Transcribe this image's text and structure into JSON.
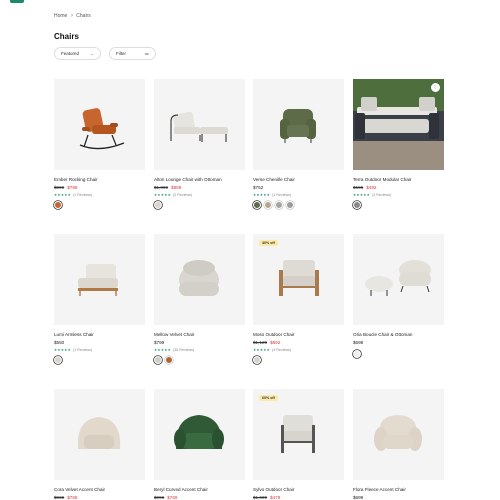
{
  "breadcrumb": {
    "home": "Home",
    "separator": ">",
    "current": "Chairs"
  },
  "page_title": "Chairs",
  "controls": {
    "sort_label": "Featured",
    "filter_label": "Filter"
  },
  "colors": {
    "brand": "#1a8a6a",
    "sale": "#d9363e",
    "star": "#1a8a6a",
    "badge_bg": "#ffe9a8"
  },
  "products": [
    {
      "name": "Ember Rocking Chair",
      "old_price": "$999",
      "price": "$799",
      "stars": "★★★★★",
      "reviews": "(1 Reviews)",
      "swatches": [
        "#c8652f"
      ],
      "icon": "rocking-chair-icon"
    },
    {
      "name": "Alton Lounge Chair with Ottoman",
      "old_price": "$1,099",
      "price": "$899",
      "stars": "★★★★★",
      "reviews": "(2 Reviews)",
      "swatches": [
        "#d8d6cf"
      ],
      "icon": "lounge-chair-icon"
    },
    {
      "name": "Verse Chenille Chair",
      "old_price": "",
      "price": "$752",
      "stars": "★★★★★",
      "reviews": "(1 Reviews)",
      "swatches": [
        "#5d6b48",
        "#b8a492",
        "#a6a6a0",
        "#9c9c9c"
      ],
      "icon": "armchair-icon"
    },
    {
      "name": "Terra Outdoor Modular Chair",
      "old_price": "$695",
      "price": "$492",
      "stars": "★★★★★",
      "reviews": "(3 Reviews)",
      "swatches": [
        "#8a8a8a"
      ],
      "icon": "modular-chair-icon"
    },
    {
      "name": "Lumi Armless Chair",
      "old_price": "",
      "price": "$550",
      "stars": "★★★★★",
      "reviews": "(1 Reviews)",
      "swatches": [
        "#d8d4cc"
      ],
      "icon": "armless-chair-icon"
    },
    {
      "name": "Mellow Velvet Chair",
      "old_price": "",
      "price": "$799",
      "stars": "★★★★★",
      "reviews": "(35 Reviews)",
      "swatches": [
        "#d1ccc4",
        "#b0642f"
      ],
      "icon": "velvet-chair-icon"
    },
    {
      "name": "Moso Outdoor Chair",
      "old_price": "$1,129",
      "price": "$692",
      "stars": "★★★★★",
      "reviews": "(4 Reviews)",
      "swatches": [
        "#d8d4cc"
      ],
      "badge": "40% off",
      "icon": "outdoor-chair-icon"
    },
    {
      "name": "Oria Boucle Chair & Ottoman",
      "old_price": "",
      "price": "$698",
      "stars": "",
      "reviews": "",
      "swatches": [
        "#eeeeee"
      ],
      "icon": "boucle-chair-icon"
    },
    {
      "name": "Cora Velvet Accent Chair",
      "old_price": "$969",
      "price": "$769",
      "icon": "accent-chair-icon"
    },
    {
      "name": "Beryl Curved Accent Chair",
      "old_price": "$996",
      "price": "$769",
      "icon": "curved-chair-icon"
    },
    {
      "name": "Sylvo Outdoor Chair",
      "old_price": "$1,699",
      "price": "$479",
      "badge": "60% off",
      "icon": "outdoor-chair-icon"
    },
    {
      "name": "Flora Fleece Accent Chair",
      "old_price": "",
      "price": "$699",
      "icon": "fleece-chair-icon"
    }
  ]
}
